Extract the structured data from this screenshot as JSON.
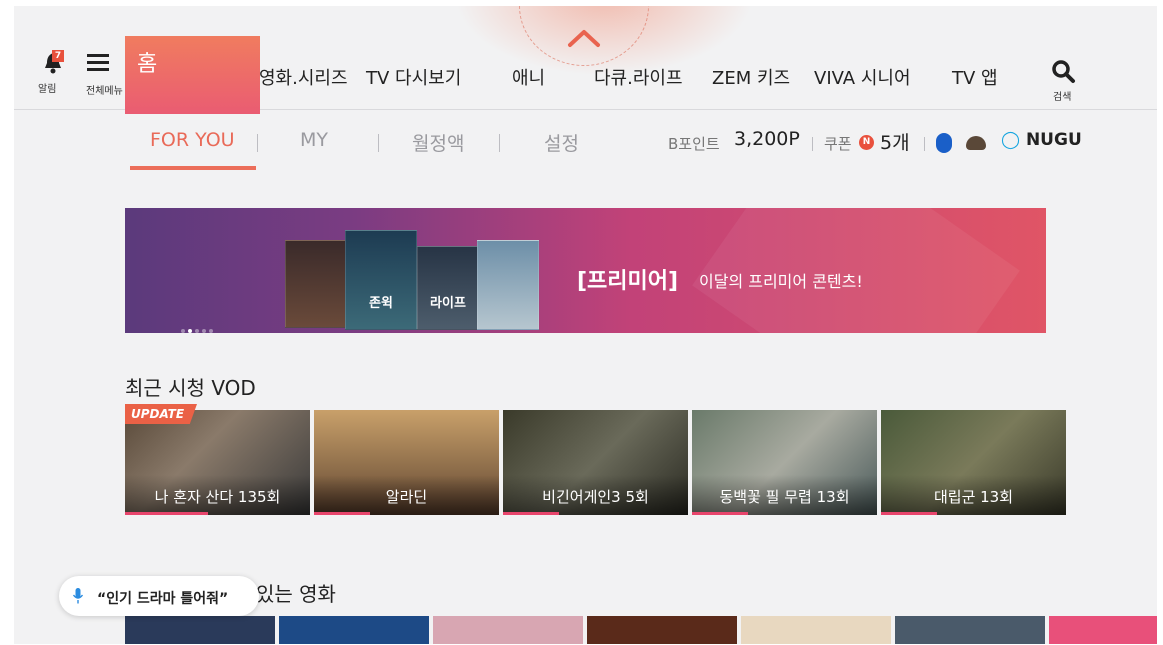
{
  "topnav": {
    "notification_badge": "7",
    "notification_label": "알림",
    "menu_label": "전체메뉴",
    "home_label": "홈",
    "items": [
      "영화.시리즈",
      "TV 다시보기",
      "애니",
      "다큐.라이프",
      "ZEM 키즈",
      "VIVA 시니어",
      "TV 앱"
    ],
    "search_label": "검색"
  },
  "subnav": {
    "tabs": [
      "FOR YOU",
      "MY",
      "월정액",
      "설정"
    ],
    "active_tab": "FOR YOU",
    "points_label": "B포인트",
    "points_value": "3,200P",
    "coupon_label": "쿠폰",
    "coupon_icon_text": "N",
    "coupon_value": "5개",
    "nugu_label": "NUGU"
  },
  "banner": {
    "title": "[프리미어]",
    "subtitle": "이달의 프리미어 콘텐츠!",
    "posters": [
      "",
      "존윅",
      "라이프",
      ""
    ]
  },
  "recent_vod": {
    "title": "최근 시청 VOD",
    "update_tag": "UPDATE",
    "items": [
      {
        "label": "나 혼자 산다 135회",
        "progress": 0.45
      },
      {
        "label": "알라딘",
        "progress": 0.3
      },
      {
        "label": "비긴어게인3 5회",
        "progress": 0.3
      },
      {
        "label": "동백꽃 필 무렵 13회",
        "progress": 0.3
      },
      {
        "label": "대립군 13회",
        "progress": 0.3
      }
    ]
  },
  "movies_section": {
    "title_visible_part": "있는 영화",
    "voice_hint": "“인기 드라마 틀어줘”"
  },
  "colors": {
    "accent": "#e96a58",
    "home_tile_top": "#f07c5f",
    "home_tile_bottom": "#ea5c72",
    "progress": "#e8456c"
  }
}
